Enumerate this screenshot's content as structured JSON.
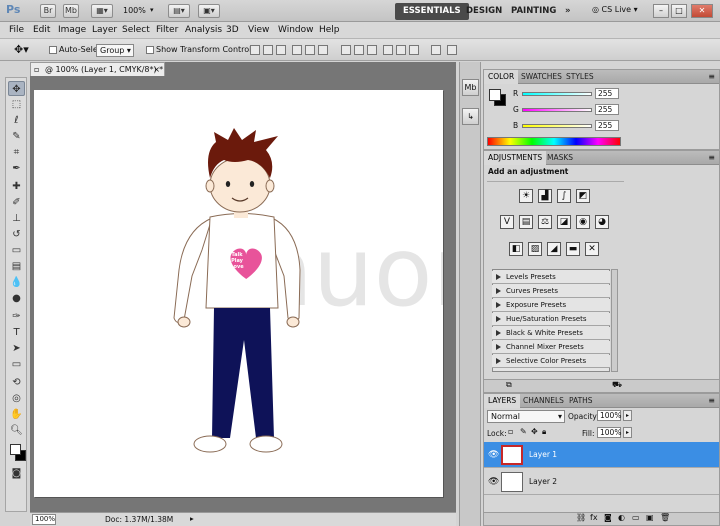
{
  "app": {
    "logo": "Ps",
    "br": "Br",
    "mb": "Mb",
    "zoom": "100%",
    "workspaces": [
      "ESSENTIALS",
      "DESIGN",
      "PAINTING"
    ],
    "more": "»",
    "cs_live": "CS Live",
    "window_controls": [
      "–",
      "□",
      "✕"
    ]
  },
  "menus": [
    "File",
    "Edit",
    "Image",
    "Layer",
    "Select",
    "Filter",
    "Analysis",
    "3D",
    "View",
    "Window",
    "Help"
  ],
  "options": {
    "auto_select_label": "Auto-Select:",
    "auto_select_value": "Group",
    "transform_label": "Show Transform Controls"
  },
  "document": {
    "tab_title": "@ 100% (Layer 1, CMYK/8*) *",
    "zoom": "100%",
    "doc_info": "Doc: 1.37M/1.38M",
    "heart_lines": [
      "Talk",
      "Play",
      "Love"
    ],
    "colors": {
      "hair": "#6b1a0c",
      "heart": "#e8539a",
      "pants": "#0e1258",
      "skin": "#fbe9d7"
    }
  },
  "color_panel": {
    "tabs": [
      "COLOR",
      "SWATCHES",
      "STYLES"
    ],
    "channels": [
      {
        "label": "R",
        "value": "255"
      },
      {
        "label": "G",
        "value": "255"
      },
      {
        "label": "B",
        "value": "255"
      }
    ]
  },
  "adjustments_panel": {
    "tabs": [
      "ADJUSTMENTS",
      "MASKS"
    ],
    "heading": "Add an adjustment",
    "presets": [
      "Levels Presets",
      "Curves Presets",
      "Exposure Presets",
      "Hue/Saturation Presets",
      "Black & White Presets",
      "Channel Mixer Presets",
      "Selective Color Presets"
    ]
  },
  "layers_panel": {
    "tabs": [
      "LAYERS",
      "CHANNELS",
      "PATHS"
    ],
    "blend_mode": "Normal",
    "opacity_label": "Opacity:",
    "opacity": "100%",
    "lock_label": "Lock:",
    "fill_label": "Fill:",
    "fill": "100%",
    "layers": [
      {
        "name": "Layer 1",
        "selected": true
      },
      {
        "name": "Layer 2",
        "selected": false
      }
    ]
  }
}
